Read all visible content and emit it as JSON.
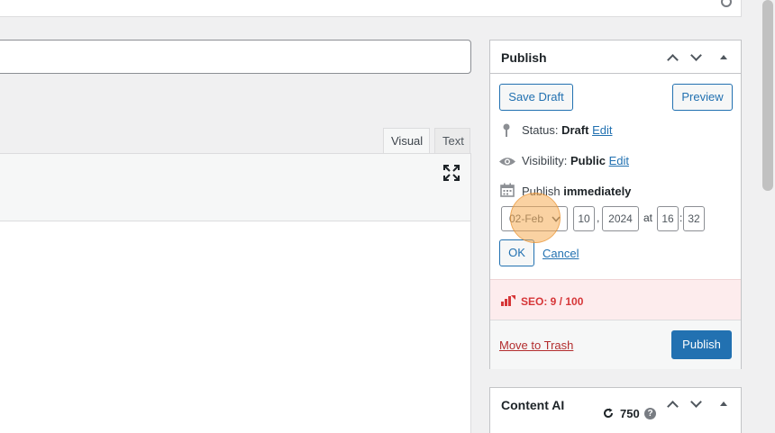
{
  "editor": {
    "tab_visual": "Visual",
    "tab_text": "Text"
  },
  "publish": {
    "title": "Publish",
    "save_draft": "Save Draft",
    "preview": "Preview",
    "status_label": "Status:",
    "status_value": "Draft",
    "status_edit": "Edit",
    "visibility_label": "Visibility:",
    "visibility_value": "Public",
    "visibility_edit": "Edit",
    "publish_label": "Publish",
    "publish_value": "immediately",
    "month": "02-Feb",
    "day": "10",
    "year": "2024",
    "at": "at",
    "hour": "16",
    "minute": "32",
    "ok": "OK",
    "cancel": "Cancel",
    "seo": "SEO: 9 / 100",
    "move_to_trash": "Move to Trash",
    "publish_button": "Publish"
  },
  "content_ai": {
    "title": "Content AI",
    "credits": "750",
    "help": "?"
  },
  "colors": {
    "primary": "#2271b1",
    "seo_bad": "#d63638",
    "seo_bg": "#fdeced",
    "trash": "#b32d2e"
  }
}
